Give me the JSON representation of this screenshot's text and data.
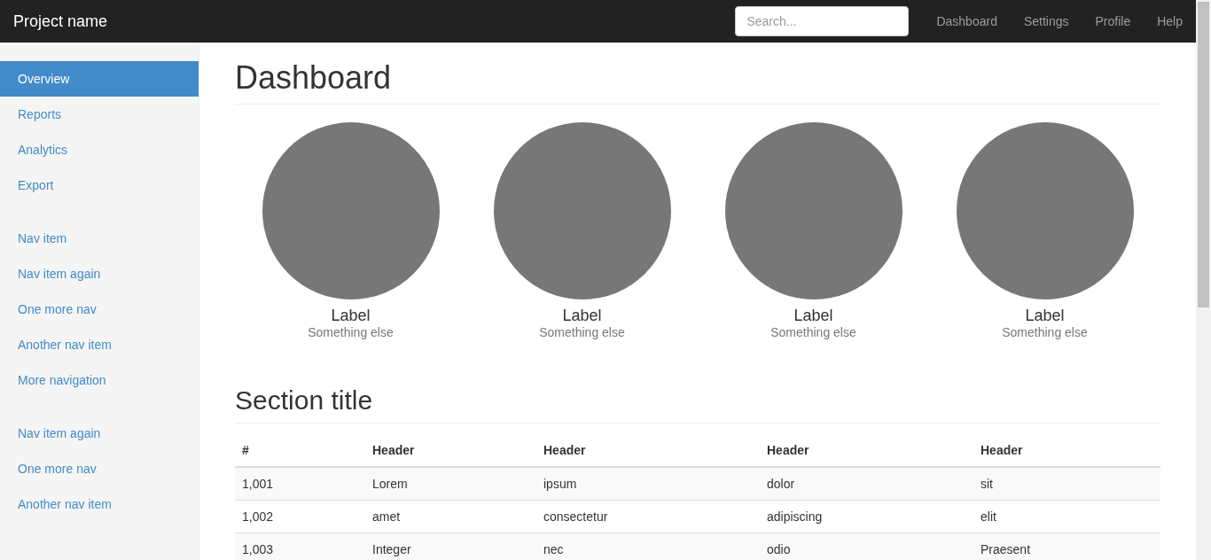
{
  "navbar": {
    "brand": "Project name",
    "search": {
      "placeholder": "Search..."
    },
    "links": [
      "Dashboard",
      "Settings",
      "Profile",
      "Help"
    ]
  },
  "sidebar": {
    "groups": [
      [
        {
          "label": "Overview",
          "selected": true
        },
        {
          "label": "Reports",
          "selected": false
        },
        {
          "label": "Analytics",
          "selected": false
        },
        {
          "label": "Export",
          "selected": false
        }
      ],
      [
        {
          "label": "Nav item",
          "selected": false
        },
        {
          "label": "Nav item again",
          "selected": false
        },
        {
          "label": "One more nav",
          "selected": false
        },
        {
          "label": "Another nav item",
          "selected": false
        },
        {
          "label": "More navigation",
          "selected": false
        }
      ],
      [
        {
          "label": "Nav item again",
          "selected": false
        },
        {
          "label": "One more nav",
          "selected": false
        },
        {
          "label": "Another nav item",
          "selected": false
        }
      ]
    ]
  },
  "page_title": "Dashboard",
  "placeholders": [
    {
      "label": "Label",
      "sublabel": "Something else"
    },
    {
      "label": "Label",
      "sublabel": "Something else"
    },
    {
      "label": "Label",
      "sublabel": "Something else"
    },
    {
      "label": "Label",
      "sublabel": "Something else"
    }
  ],
  "section_title": "Section title",
  "table": {
    "columns": [
      "#",
      "Header",
      "Header",
      "Header",
      "Header"
    ],
    "rows": [
      [
        "1,001",
        "Lorem",
        "ipsum",
        "dolor",
        "sit"
      ],
      [
        "1,002",
        "amet",
        "consectetur",
        "adipiscing",
        "elit"
      ],
      [
        "1,003",
        "Integer",
        "nec",
        "odio",
        "Praesent"
      ]
    ]
  }
}
